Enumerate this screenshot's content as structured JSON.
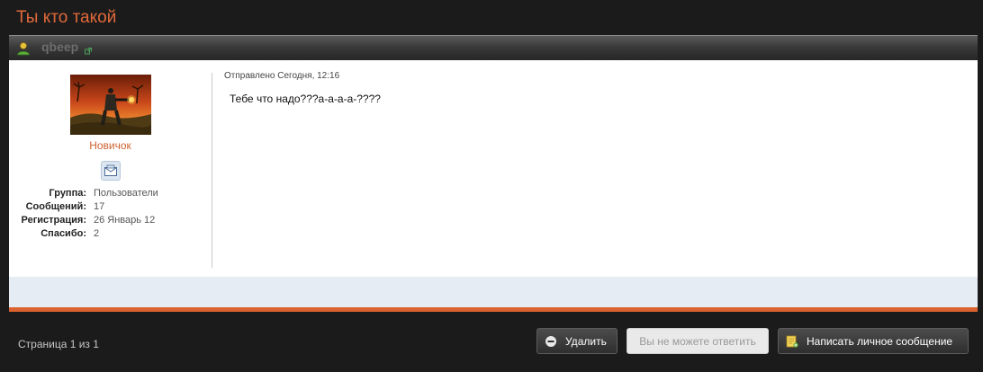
{
  "topic": {
    "title": "Ты кто такой"
  },
  "post": {
    "author": {
      "username": "qbeep",
      "rank": "Новичок",
      "info": [
        {
          "label": "Группа:",
          "value": "Пользователи"
        },
        {
          "label": "Сообщений:",
          "value": "17"
        },
        {
          "label": "Регистрация:",
          "value": "26 Январь 12"
        },
        {
          "label": "Спасибо:",
          "value": "2"
        }
      ]
    },
    "date": "Отправлено Сегодня, 12:16",
    "text": "Тебе что надо???а-а-а-а-????"
  },
  "footer": {
    "pagination": "Страница 1 из 1",
    "delete_label": "Удалить",
    "reply_label": "Вы не можете ответить",
    "pm_label": "Написать личное сообщение"
  },
  "icons": {
    "user": "user-icon",
    "online": "external-link-icon",
    "pm": "envelope-icon",
    "delete": "minus-circle-icon",
    "compose": "compose-note-icon"
  },
  "colors": {
    "accent": "#e0693a",
    "rank": "#d0622f",
    "background": "#1b1b1b",
    "post_footer": "#e6ecf3"
  }
}
